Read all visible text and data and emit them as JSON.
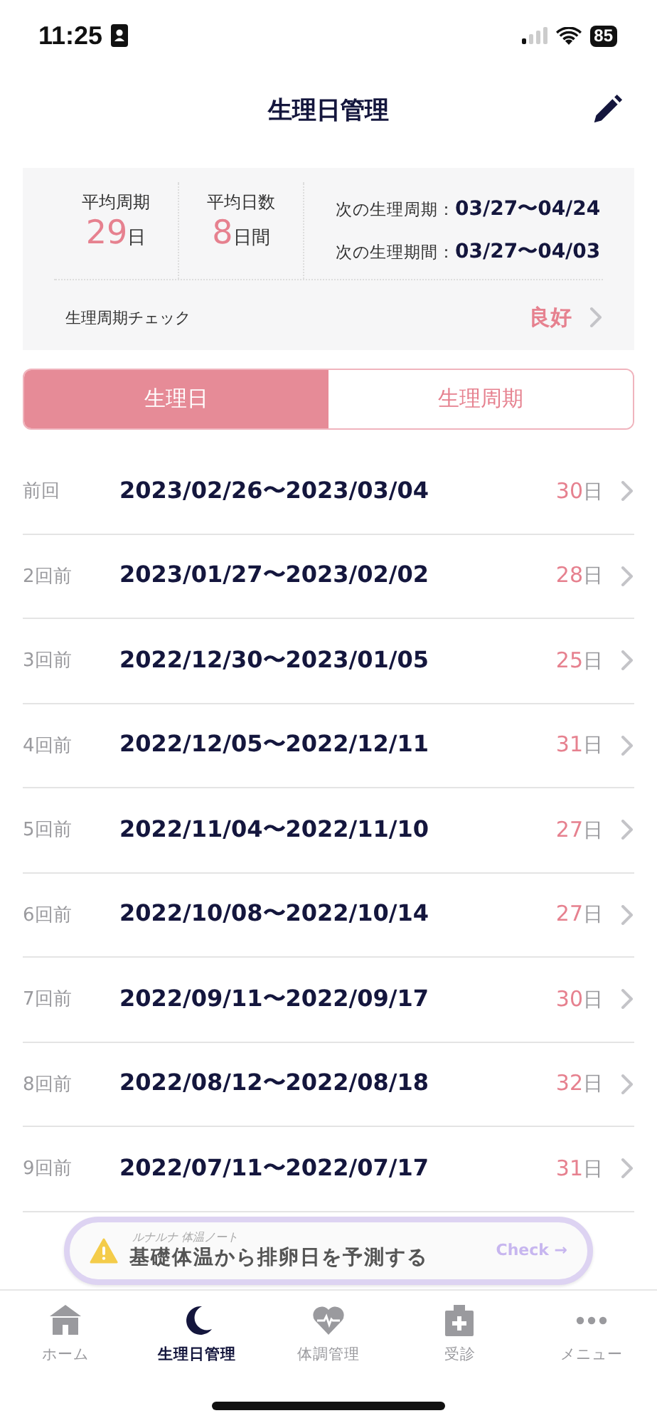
{
  "status_bar": {
    "time": "11:25",
    "battery": "85"
  },
  "header": {
    "title": "生理日管理"
  },
  "summary": {
    "stats": [
      {
        "label": "平均周期",
        "value": "29",
        "unit": "日"
      },
      {
        "label": "平均日数",
        "value": "8",
        "unit": "日間"
      }
    ],
    "next": [
      {
        "label": "次の生理周期：",
        "value": "03/27〜04/24"
      },
      {
        "label": "次の生理期間：",
        "value": "03/27〜04/03"
      }
    ],
    "check": {
      "label": "生理周期チェック",
      "value": "良好"
    }
  },
  "tabs": [
    {
      "label": "生理日",
      "selected": true
    },
    {
      "label": "生理周期",
      "selected": false
    }
  ],
  "periods": [
    {
      "label": "前回",
      "range": "2023/02/26〜2023/03/04",
      "days": "30",
      "unit": "日"
    },
    {
      "label": "2回前",
      "range": "2023/01/27〜2023/02/02",
      "days": "28",
      "unit": "日"
    },
    {
      "label": "3回前",
      "range": "2022/12/30〜2023/01/05",
      "days": "25",
      "unit": "日"
    },
    {
      "label": "4回前",
      "range": "2022/12/05〜2022/12/11",
      "days": "31",
      "unit": "日"
    },
    {
      "label": "5回前",
      "range": "2022/11/04〜2022/11/10",
      "days": "27",
      "unit": "日"
    },
    {
      "label": "6回前",
      "range": "2022/10/08〜2022/10/14",
      "days": "27",
      "unit": "日"
    },
    {
      "label": "7回前",
      "range": "2022/09/11〜2022/09/17",
      "days": "30",
      "unit": "日"
    },
    {
      "label": "8回前",
      "range": "2022/08/12〜2022/08/18",
      "days": "32",
      "unit": "日"
    },
    {
      "label": "9回前",
      "range": "2022/07/11〜2022/07/17",
      "days": "31",
      "unit": "日"
    }
  ],
  "banner": {
    "caption": "ルナルナ 体温ノート",
    "text": "基礎体温から排卵日を予測する",
    "action": "Check →"
  },
  "nav": [
    {
      "kind": "home",
      "label": "ホーム",
      "selected": false
    },
    {
      "kind": "moon",
      "label": "生理日管理",
      "selected": true
    },
    {
      "kind": "heart",
      "label": "体調管理",
      "selected": false
    },
    {
      "kind": "clinic",
      "label": "受診",
      "selected": false
    },
    {
      "kind": "more",
      "label": "メニュー",
      "selected": false
    }
  ]
}
